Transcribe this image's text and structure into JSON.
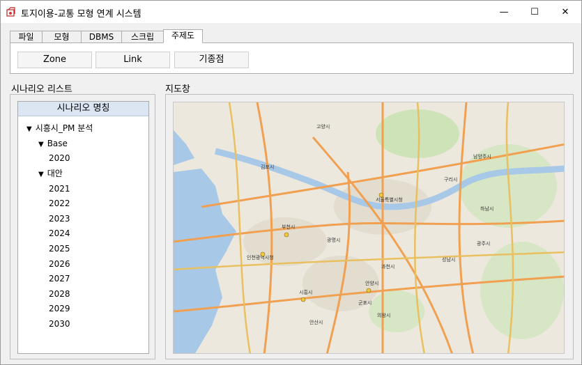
{
  "window": {
    "title": "토지이용-교통 모형 연계 시스템",
    "controls": {
      "minimize": "—",
      "maximize": "☐",
      "close": "✕"
    }
  },
  "tabs": [
    "파일",
    "모형",
    "DBMS",
    "스크립트",
    "주제도"
  ],
  "active_tab": "주제도",
  "toolbar": {
    "zone_label": "Zone",
    "link_label": "Link",
    "origin_label": "기종점"
  },
  "scenario": {
    "group_label": "시나리오 리스트",
    "header": "시나리오 명칭",
    "root": "시흥시_PM 분석",
    "base_label": "Base",
    "base_years": [
      "2020"
    ],
    "alt_label": "대안",
    "alt_years": [
      "2021",
      "2022",
      "2023",
      "2024",
      "2025",
      "2026",
      "2027",
      "2028",
      "2029",
      "2030"
    ]
  },
  "map": {
    "group_label": "지도창",
    "labels": {
      "seoul": "서울특별시청",
      "incheon": "인천광역시청",
      "bucheon": "부천시",
      "gwangmyeong": "광명시",
      "anyang": "안양시",
      "gwacheon": "과천시",
      "gunpo": "군포시",
      "uiwang": "의왕시",
      "siheung": "시흥시",
      "ansan": "안산시",
      "goyang": "고양시",
      "gimpo": "김포시",
      "guri": "구리시",
      "hanam": "하남시",
      "gwangju": "광주시",
      "seongnam": "성남시",
      "namyangju": "남양주시"
    },
    "colors": {
      "land": "#ece8de",
      "water": "#a8c8e8",
      "green": "#cfe3b8",
      "major_road": "#f0a050",
      "highway": "#e8c060",
      "urban": "#e3ddd0"
    }
  }
}
